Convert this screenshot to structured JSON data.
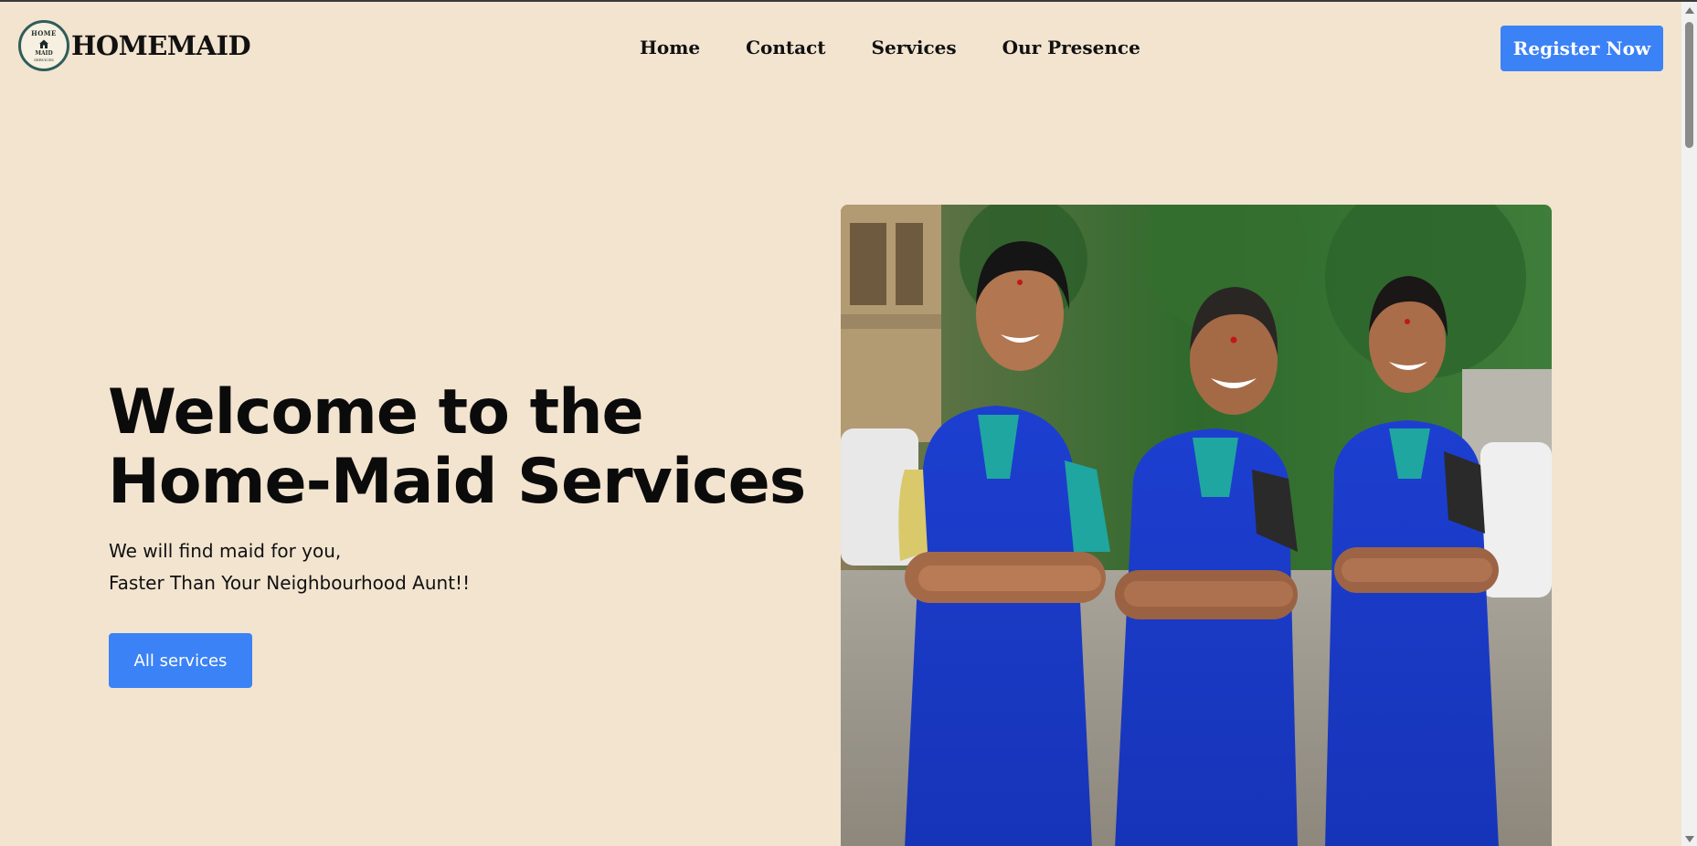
{
  "header": {
    "logo": {
      "top_text": "HOME",
      "middle_text": "MAID",
      "bottom_text": "SERVICES"
    },
    "brand": "HOMEMAID",
    "nav": [
      {
        "label": "Home"
      },
      {
        "label": "Contact"
      },
      {
        "label": "Services"
      },
      {
        "label": "Our Presence"
      }
    ],
    "register_label": "Register Now"
  },
  "hero": {
    "title_line1": "Welcome to the",
    "title_line2": "Home-Maid Services",
    "subtitle_line1": "We will find maid for you,",
    "subtitle_line2": "Faster Than Your Neighbourhood Aunt!!",
    "cta_label": "All services",
    "photo": "three smiling women in blue uniforms with arms crossed"
  },
  "colors": {
    "background": "#f2e4cf",
    "accent": "#3b82f6",
    "text": "#111111"
  }
}
